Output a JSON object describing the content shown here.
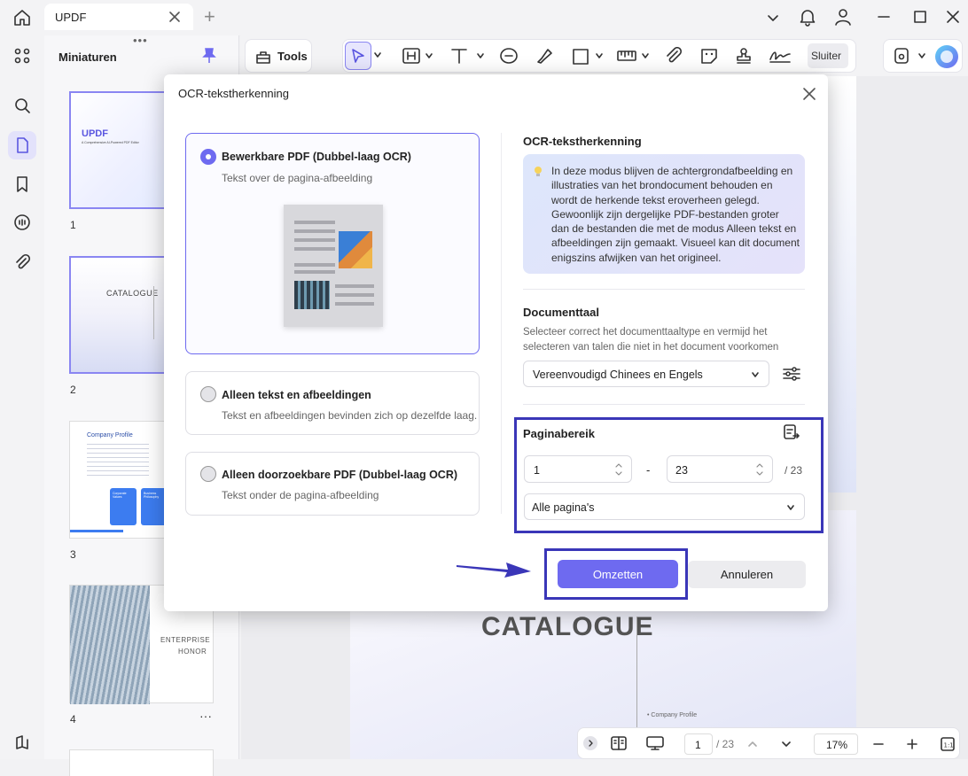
{
  "app": {
    "tab_title": "UPDF",
    "new_tab": "+"
  },
  "thumbnails": {
    "title": "Miniaturen",
    "pages": [
      {
        "num": "1",
        "brand": "UPDF",
        "subtitle": "A Comprehensive AI-Powered PDF Editor"
      },
      {
        "num": "2",
        "title": "CATALOGUE"
      },
      {
        "num": "3",
        "title": "Company Profile",
        "chip1": "Corporate Values",
        "chip2": "Business Philosophy"
      },
      {
        "num": "4",
        "title1": "ENTERPRISE",
        "title2": "HONOR",
        "more": "···"
      }
    ]
  },
  "toolbar": {
    "tools_label": "Tools",
    "close_label": "Sluiter"
  },
  "dialog": {
    "title": "OCR-tekstherkenning",
    "options": [
      {
        "title": "Bewerkbare PDF (Dubbel-laag OCR)",
        "subtitle": "Tekst over de pagina-afbeelding",
        "selected": true
      },
      {
        "title": "Alleen tekst en afbeeldingen",
        "subtitle": "Tekst en afbeeldingen bevinden zich op dezelfde laag.",
        "selected": false
      },
      {
        "title": "Alleen doorzoekbare PDF (Dubbel-laag OCR)",
        "subtitle": "Tekst onder de pagina-afbeelding",
        "selected": false
      }
    ],
    "info_heading": "OCR-tekstherkenning",
    "info_text": "In deze modus blijven de achtergrondafbeelding en illustraties van het brondocument behouden en wordt de herkende tekst eroverheen gelegd. Gewoonlijk zijn dergelijke PDF-bestanden groter dan de bestanden die met de modus Alleen tekst en afbeeldingen zijn gemaakt. Visueel kan dit document enigszins afwijken van het origineel.",
    "language_heading": "Documenttaal",
    "language_desc": "Selecteer correct het documenttaaltype en vermijd het selecteren van talen die niet in het document voorkomen",
    "language_value": "Vereenvoudigd Chinees en Engels",
    "range_heading": "Paginabereik",
    "range_from": "1",
    "range_sep": "-",
    "range_to": "23",
    "range_total": "/ 23",
    "range_select": "Alle pagina's",
    "convert_label": "Omzetten",
    "cancel_label": "Annuleren"
  },
  "document": {
    "page_title": "CATALOGUE",
    "toc_item": "• Company Profile"
  },
  "bottombar": {
    "page_current": "1",
    "page_total": "/ 23",
    "zoom": "17%"
  },
  "colors": {
    "accent": "#6e6af0",
    "highlight_box": "#3a36b8"
  }
}
